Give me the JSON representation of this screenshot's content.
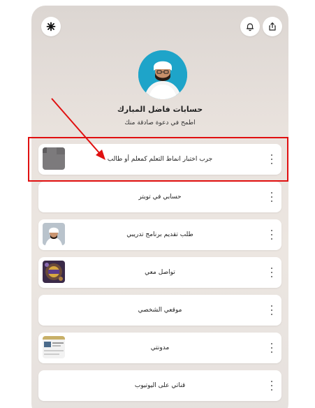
{
  "header": {
    "left_button_icon": "sparkle-icon",
    "bell_icon": "bell-icon",
    "share_icon": "share-icon"
  },
  "profile": {
    "name": "حسابات فاضل المبارك",
    "bio": "اطمح في دعوة صادقة منك"
  },
  "links": [
    {
      "label": "جرب اختبار انماط التعلم كمعلم أو طالب",
      "thumb": "gray-thumb",
      "highlighted": true
    },
    {
      "label": "حسابي في تويتر",
      "thumb": ""
    },
    {
      "label": "طلب تقديم برنامج تدريبي",
      "thumb": "portrait-thumb"
    },
    {
      "label": "تواصل معي",
      "thumb": "game-thumb"
    },
    {
      "label": "موقعي الشخصي",
      "thumb": ""
    },
    {
      "label": "مدونتي",
      "thumb": "webpage-thumb"
    },
    {
      "label": "قناتي على اليوتيوب",
      "thumb": ""
    }
  ],
  "colors": {
    "annotation_red": "#e01010",
    "avatar_bg": "#1ea4c9"
  }
}
